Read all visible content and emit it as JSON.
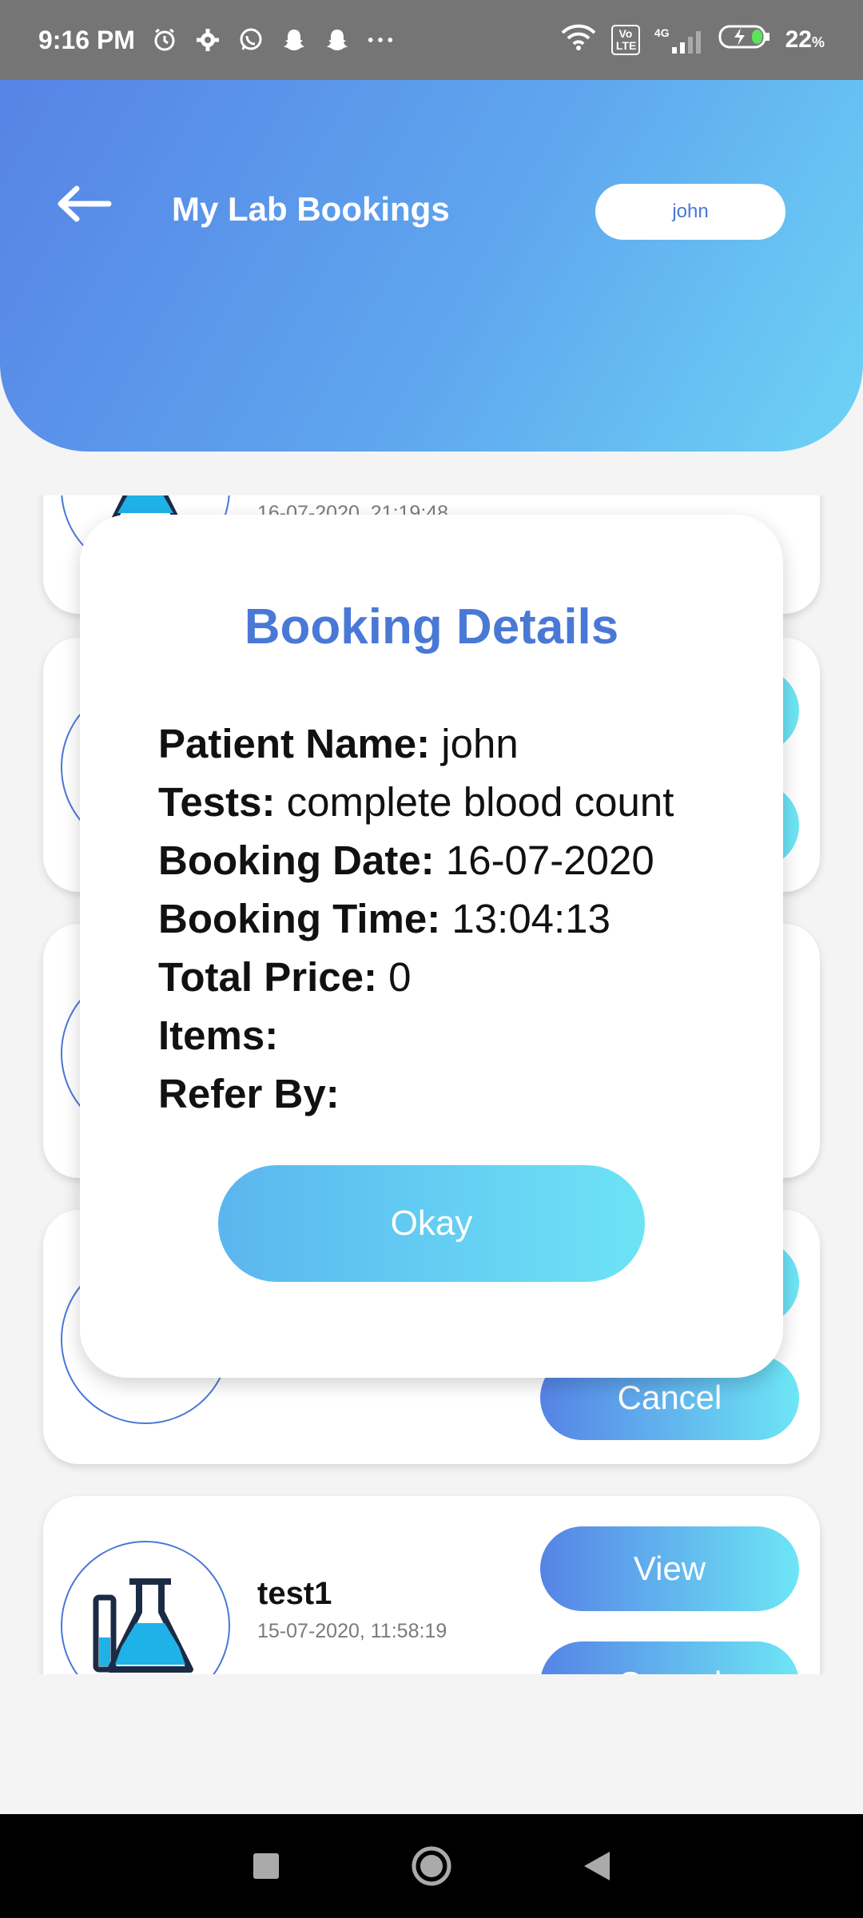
{
  "status_bar": {
    "time": "9:16 PM",
    "battery": "22",
    "battery_unit": "%",
    "network": "4G",
    "volte": "Vo LTE"
  },
  "header": {
    "title": "My Lab Bookings",
    "user": "john"
  },
  "bookings": [
    {
      "title": "",
      "date": "16-07-2020, 21:19:48",
      "view_label": "",
      "cancel_label": ""
    },
    {
      "title": "",
      "date": "",
      "view_label": "",
      "cancel_label": ""
    },
    {
      "title": "",
      "date": "",
      "view_label": "",
      "cancel_label": ""
    },
    {
      "title": "",
      "date": "",
      "view_label": "",
      "cancel_label": "Cancel"
    },
    {
      "title": "test1",
      "date": "15-07-2020, 11:58:19",
      "view_label": "View",
      "cancel_label": "Cancel"
    }
  ],
  "dialog": {
    "title": "Booking Details",
    "fields": [
      {
        "label": "Patient Name:",
        "value": "john"
      },
      {
        "label": "Tests:",
        "value": "complete blood count"
      },
      {
        "label": "Booking Date:",
        "value": "16-07-2020"
      },
      {
        "label": "Booking Time:",
        "value": "13:04:13"
      },
      {
        "label": "Total Price:",
        "value": "0"
      },
      {
        "label": "Items:",
        "value": ""
      },
      {
        "label": "Refer By:",
        "value": ""
      }
    ],
    "okay_label": "Okay"
  },
  "colors": {
    "accent": "#4a78d6",
    "header_start": "#5683e6",
    "header_end": "#6dd3f5"
  }
}
